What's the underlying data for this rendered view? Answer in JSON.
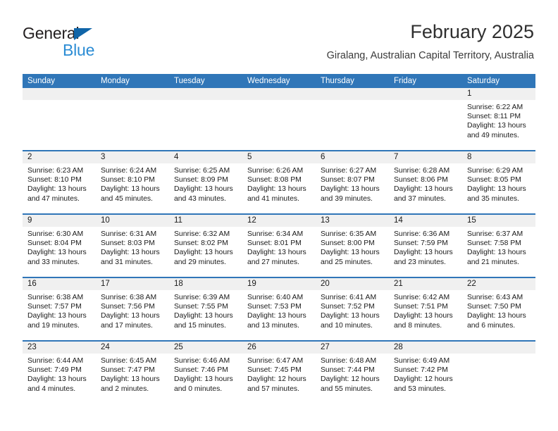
{
  "brand": {
    "name_part1": "General",
    "name_part2": "Blue",
    "triangle_color": "#1065a8",
    "blue_color": "#2b8cd4"
  },
  "header": {
    "title": "February 2025",
    "subtitle": "Giralang, Australian Capital Territory, Australia"
  },
  "theme": {
    "header_blue": "#3076b8",
    "daynum_band": "#f0f0f0",
    "text": "#1a1a1a"
  },
  "calendar": {
    "weekdays": [
      "Sunday",
      "Monday",
      "Tuesday",
      "Wednesday",
      "Thursday",
      "Friday",
      "Saturday"
    ],
    "weeks": [
      [
        {
          "day": "",
          "empty": true
        },
        {
          "day": "",
          "empty": true
        },
        {
          "day": "",
          "empty": true
        },
        {
          "day": "",
          "empty": true
        },
        {
          "day": "",
          "empty": true
        },
        {
          "day": "",
          "empty": true
        },
        {
          "day": "1",
          "sunrise": "Sunrise: 6:22 AM",
          "sunset": "Sunset: 8:11 PM",
          "daylight": "Daylight: 13 hours and 49 minutes."
        }
      ],
      [
        {
          "day": "2",
          "sunrise": "Sunrise: 6:23 AM",
          "sunset": "Sunset: 8:10 PM",
          "daylight": "Daylight: 13 hours and 47 minutes."
        },
        {
          "day": "3",
          "sunrise": "Sunrise: 6:24 AM",
          "sunset": "Sunset: 8:10 PM",
          "daylight": "Daylight: 13 hours and 45 minutes."
        },
        {
          "day": "4",
          "sunrise": "Sunrise: 6:25 AM",
          "sunset": "Sunset: 8:09 PM",
          "daylight": "Daylight: 13 hours and 43 minutes."
        },
        {
          "day": "5",
          "sunrise": "Sunrise: 6:26 AM",
          "sunset": "Sunset: 8:08 PM",
          "daylight": "Daylight: 13 hours and 41 minutes."
        },
        {
          "day": "6",
          "sunrise": "Sunrise: 6:27 AM",
          "sunset": "Sunset: 8:07 PM",
          "daylight": "Daylight: 13 hours and 39 minutes."
        },
        {
          "day": "7",
          "sunrise": "Sunrise: 6:28 AM",
          "sunset": "Sunset: 8:06 PM",
          "daylight": "Daylight: 13 hours and 37 minutes."
        },
        {
          "day": "8",
          "sunrise": "Sunrise: 6:29 AM",
          "sunset": "Sunset: 8:05 PM",
          "daylight": "Daylight: 13 hours and 35 minutes."
        }
      ],
      [
        {
          "day": "9",
          "sunrise": "Sunrise: 6:30 AM",
          "sunset": "Sunset: 8:04 PM",
          "daylight": "Daylight: 13 hours and 33 minutes."
        },
        {
          "day": "10",
          "sunrise": "Sunrise: 6:31 AM",
          "sunset": "Sunset: 8:03 PM",
          "daylight": "Daylight: 13 hours and 31 minutes."
        },
        {
          "day": "11",
          "sunrise": "Sunrise: 6:32 AM",
          "sunset": "Sunset: 8:02 PM",
          "daylight": "Daylight: 13 hours and 29 minutes."
        },
        {
          "day": "12",
          "sunrise": "Sunrise: 6:34 AM",
          "sunset": "Sunset: 8:01 PM",
          "daylight": "Daylight: 13 hours and 27 minutes."
        },
        {
          "day": "13",
          "sunrise": "Sunrise: 6:35 AM",
          "sunset": "Sunset: 8:00 PM",
          "daylight": "Daylight: 13 hours and 25 minutes."
        },
        {
          "day": "14",
          "sunrise": "Sunrise: 6:36 AM",
          "sunset": "Sunset: 7:59 PM",
          "daylight": "Daylight: 13 hours and 23 minutes."
        },
        {
          "day": "15",
          "sunrise": "Sunrise: 6:37 AM",
          "sunset": "Sunset: 7:58 PM",
          "daylight": "Daylight: 13 hours and 21 minutes."
        }
      ],
      [
        {
          "day": "16",
          "sunrise": "Sunrise: 6:38 AM",
          "sunset": "Sunset: 7:57 PM",
          "daylight": "Daylight: 13 hours and 19 minutes."
        },
        {
          "day": "17",
          "sunrise": "Sunrise: 6:38 AM",
          "sunset": "Sunset: 7:56 PM",
          "daylight": "Daylight: 13 hours and 17 minutes."
        },
        {
          "day": "18",
          "sunrise": "Sunrise: 6:39 AM",
          "sunset": "Sunset: 7:55 PM",
          "daylight": "Daylight: 13 hours and 15 minutes."
        },
        {
          "day": "19",
          "sunrise": "Sunrise: 6:40 AM",
          "sunset": "Sunset: 7:53 PM",
          "daylight": "Daylight: 13 hours and 13 minutes."
        },
        {
          "day": "20",
          "sunrise": "Sunrise: 6:41 AM",
          "sunset": "Sunset: 7:52 PM",
          "daylight": "Daylight: 13 hours and 10 minutes."
        },
        {
          "day": "21",
          "sunrise": "Sunrise: 6:42 AM",
          "sunset": "Sunset: 7:51 PM",
          "daylight": "Daylight: 13 hours and 8 minutes."
        },
        {
          "day": "22",
          "sunrise": "Sunrise: 6:43 AM",
          "sunset": "Sunset: 7:50 PM",
          "daylight": "Daylight: 13 hours and 6 minutes."
        }
      ],
      [
        {
          "day": "23",
          "sunrise": "Sunrise: 6:44 AM",
          "sunset": "Sunset: 7:49 PM",
          "daylight": "Daylight: 13 hours and 4 minutes."
        },
        {
          "day": "24",
          "sunrise": "Sunrise: 6:45 AM",
          "sunset": "Sunset: 7:47 PM",
          "daylight": "Daylight: 13 hours and 2 minutes."
        },
        {
          "day": "25",
          "sunrise": "Sunrise: 6:46 AM",
          "sunset": "Sunset: 7:46 PM",
          "daylight": "Daylight: 13 hours and 0 minutes."
        },
        {
          "day": "26",
          "sunrise": "Sunrise: 6:47 AM",
          "sunset": "Sunset: 7:45 PM",
          "daylight": "Daylight: 12 hours and 57 minutes."
        },
        {
          "day": "27",
          "sunrise": "Sunrise: 6:48 AM",
          "sunset": "Sunset: 7:44 PM",
          "daylight": "Daylight: 12 hours and 55 minutes."
        },
        {
          "day": "28",
          "sunrise": "Sunrise: 6:49 AM",
          "sunset": "Sunset: 7:42 PM",
          "daylight": "Daylight: 12 hours and 53 minutes."
        },
        {
          "day": "",
          "empty": true,
          "blank_cell": true
        }
      ]
    ]
  }
}
